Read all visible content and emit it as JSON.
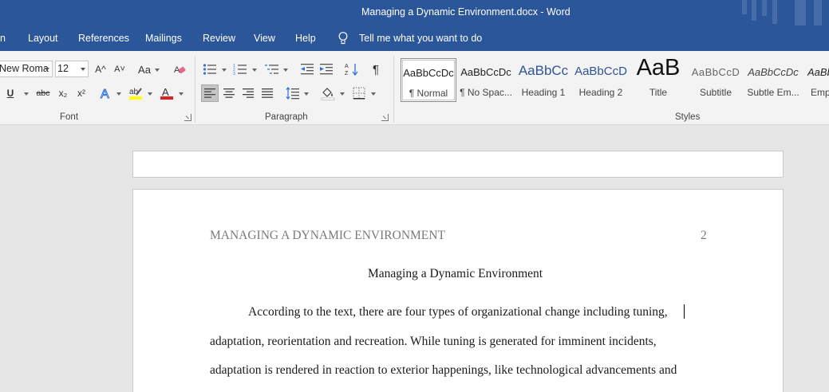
{
  "window": {
    "title": "Managing a Dynamic Environment.docx  -  Word"
  },
  "menu": {
    "items": [
      "n",
      "Layout",
      "References",
      "Mailings",
      "Review",
      "View",
      "Help"
    ],
    "tell_me": "Tell me what you want to do"
  },
  "ribbon": {
    "font": {
      "family": "New Roma",
      "size": "12",
      "group_label": "Font",
      "buttons": [
        "A^",
        "A˅",
        "Aa",
        "U",
        "abc",
        "x₂",
        "x²"
      ]
    },
    "paragraph": {
      "group_label": "Paragraph"
    },
    "styles": {
      "group_label": "Styles",
      "items": [
        {
          "preview": "AaBbCcDc",
          "name": "¶ Normal"
        },
        {
          "preview": "AaBbCcDc",
          "name": "¶ No Spac..."
        },
        {
          "preview": "AaBbCc",
          "name": "Heading 1"
        },
        {
          "preview": "AaBbCcD",
          "name": "Heading 2"
        },
        {
          "preview": "AaB",
          "name": "Title"
        },
        {
          "preview": "AaBbCcD",
          "name": "Subtitle"
        },
        {
          "preview": "AaBbCcDc",
          "name": "Subtle Em..."
        },
        {
          "preview": "AaBb",
          "name": "Emp"
        }
      ]
    }
  },
  "document": {
    "running_head": "MANAGING A DYNAMIC ENVIRONMENT",
    "page_number": "2",
    "heading": "Managing a Dynamic Environment",
    "lines": [
      "According to the text, there are four types of organizational change including tuning,",
      "adaptation, reorientation and recreation. While tuning is generated for imminent incidents,",
      "adaptation is rendered in reaction to exterior happenings, like technological advancements and"
    ]
  },
  "colors": {
    "title_bar": "#2b579a",
    "ribbon": "#f3f3f3",
    "canvas": "#e6e6e6",
    "heading_preview": "#2f5496"
  }
}
